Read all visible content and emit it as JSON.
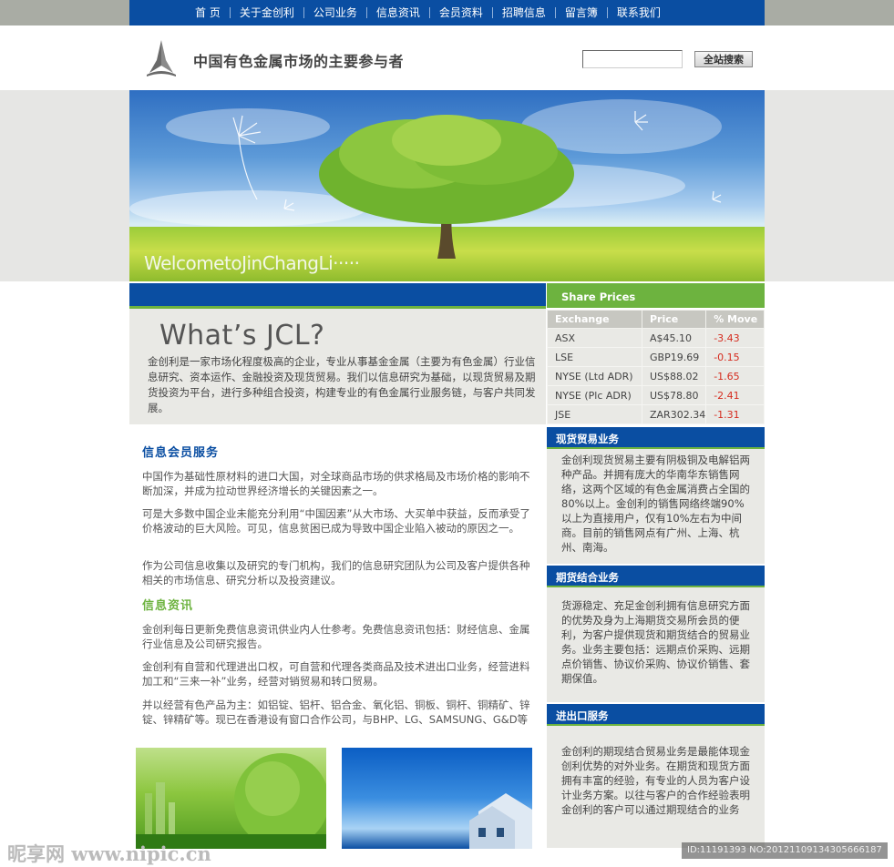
{
  "nav": {
    "items": [
      "首 页",
      "关于金创利",
      "公司业务",
      "信息资讯",
      "会员资料",
      "招聘信息",
      "留言簿",
      "联系我们"
    ]
  },
  "header": {
    "slogan": "中国有色金属市场的主要参与者",
    "search_button": "全站搜索",
    "search_value": ""
  },
  "banner": {
    "welcome": "WelcometoJinChangLi·····"
  },
  "intro": {
    "title": "What’s JCL?",
    "text": "金创利是一家市场化程度极高的企业，专业从事基金金属（主要为有色金属）行业信息研究、资本运作、金融投资及现货贸易。我们以信息研究为基础，以现货贸易及期货投资为平台，进行多种组合投资，构建专业的有色金属行业服务链，与客户共同发展。"
  },
  "member_service": {
    "title": "信息会员服务",
    "paragraphs": [
      "中国作为基础性原材料的进口大国，对全球商品市场的供求格局及市场价格的影响不断加深，并成为拉动世界经济增长的关键因素之一。",
      "可是大多数中国企业未能充分利用“中国因素”从大市场、大买单中获益，反而承受了价格波动的巨大风险。可见，信息贫困已成为导致中国企业陷入被动的原因之一。",
      "作为公司信息收集以及研究的专门机构，我们的信息研究团队为公司及客户提供各种相关的市场信息、研究分析以及投资建议。"
    ]
  },
  "news": {
    "title": "信息资讯",
    "paragraphs": [
      "金创利每日更新免费信息资讯供业内人仕参考。免费信息资讯包括：财经信息、金属行业信息及公司研究报告。",
      "金创利有自营和代理进出口权，可自营和代理各类商品及技术进出口业务，经营进料加工和“三来一补”业务，经营对销贸易和转口贸易。",
      "并以经营有色产品为主：如铝锭、铝杆、铝合金、氧化铝、铜板、铜杆、铜精矿、锌锭、锌精矿等。现已在香港设有窗口合作公司，与BHP、LG、SAMSUNG、G&D等"
    ]
  },
  "share_prices": {
    "title": "Share Prices",
    "headers": [
      "Exchange",
      "Price",
      "% Move"
    ],
    "rows": [
      [
        "ASX",
        "A$45.10",
        "-3.43"
      ],
      [
        "LSE",
        "GBP19.69",
        "-0.15"
      ],
      [
        "NYSE (Ltd ADR)",
        "US$88.02",
        "-1.65"
      ],
      [
        "NYSE (Plc ADR)",
        "US$78.80",
        "-2.41"
      ],
      [
        "JSE",
        "ZAR302.34",
        "-1.31"
      ]
    ],
    "negative_color": "#d52b1e"
  },
  "boxes": [
    {
      "title": "现货贸易业务",
      "text": "金创利现货贸易主要有阴极铜及电解铝两种产品。并拥有庞大的华南华东销售网络，这两个区域的有色金属消费占全国的80%以上。金创利的销售网络终端90%以上为直接用户，仅有10%左右为中间商。目前的销售网点有广州、上海、杭州、南海。"
    },
    {
      "title": "期货结合业务",
      "text": "货源稳定、充足金创利拥有信息研究方面的优势及身为上海期货交易所会员的便利，为客户提供现货和期货结合的贸易业务。业务主要包括：远期点价采购、远期点价销售、协议价采购、协议价销售、套期保值。"
    },
    {
      "title": "进出口服务",
      "text": "金创利的期现结合贸易业务是最能体现金创利优势的对外业务。在期货和现货方面拥有丰富的经验，有专业的人员为客户设计业务方案。以往与客户的合作经验表明金创利的客户可以通过期现结合的业务"
    }
  ],
  "watermark": {
    "left": "昵享网 www.nipic.cn",
    "right": "ID:11191393 NO:20121109134305666187"
  },
  "colors": {
    "brand_blue": "#0a4ea2",
    "accent_green": "#6db33f",
    "panel_gray": "#e9e9e5"
  }
}
